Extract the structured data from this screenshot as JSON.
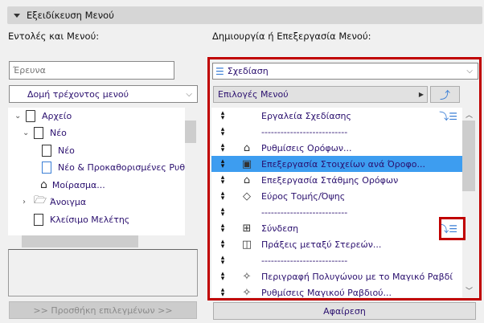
{
  "header": {
    "title": "Εξειδίκευση Μενού"
  },
  "left": {
    "title": "Εντολές και Μενού:",
    "search_placeholder": "Έρευνα",
    "structure_select": "Δομή τρέχοντος μενού",
    "tree": [
      {
        "label": "Αρχείο",
        "level": 0,
        "expanded": true,
        "icon": "menu-list-icon"
      },
      {
        "label": "Νέο",
        "level": 1,
        "expanded": true,
        "icon": "document-icon"
      },
      {
        "label": "Νέο",
        "level": 2,
        "icon": "document-icon"
      },
      {
        "label": "Νέο & Προκαθορισμένες Ρυθμ",
        "level": 2,
        "icon": "new-settings-icon"
      },
      {
        "label": "Μοίρασμα...",
        "level": 2,
        "icon": "share-house-icon"
      },
      {
        "label": "Άνοιγμα",
        "level": 1,
        "expanded": false,
        "icon": "open-folder-icon"
      },
      {
        "label": "Κλείσιμο Μελέτης",
        "level": 1,
        "icon": "close-document-icon"
      }
    ],
    "add_button": ">> Προσθήκη επιλεγμένων >>"
  },
  "right": {
    "title": "Δημιουργία ή Επεξεργασία Μενού:",
    "menu_select": "Σχεδίαση",
    "options_label": "Επιλογές Μενού",
    "items": [
      {
        "label": "Εργαλεία Σχεδίασης",
        "icon": "",
        "badge": true
      },
      {
        "label": "---------------------------",
        "icon": ""
      },
      {
        "label": "Ρυθμίσεις Ορόφων...",
        "icon": "story-settings-icon"
      },
      {
        "label": "Επεξεργασία Στοιχείων ανά Όροφο...",
        "icon": "edit-by-story-icon",
        "selected": true
      },
      {
        "label": "Επεξεργασία Στάθμης Ορόφων",
        "icon": "story-levels-icon"
      },
      {
        "label": "Εύρος Τομής/Όψης",
        "icon": "section-range-icon"
      },
      {
        "label": "---------------------------",
        "icon": ""
      },
      {
        "label": "Σύνδεση",
        "icon": "connect-icon",
        "badge": true
      },
      {
        "label": "Πράξεις μεταξύ Στερεών...",
        "icon": "solid-ops-icon"
      },
      {
        "label": "---------------------------",
        "icon": ""
      },
      {
        "label": "Περιγραφή Πολυγώνου με το Μαγικό Ραβδί",
        "icon": "magic-wand-icon"
      },
      {
        "label": "Ρυθμίσεις Μαγικού Ραβδιού...",
        "icon": "magic-wand-settings-icon"
      }
    ],
    "remove_button": "Αφαίρεση"
  },
  "colors": {
    "highlight": "#c00000",
    "selection": "#3d9df0"
  }
}
